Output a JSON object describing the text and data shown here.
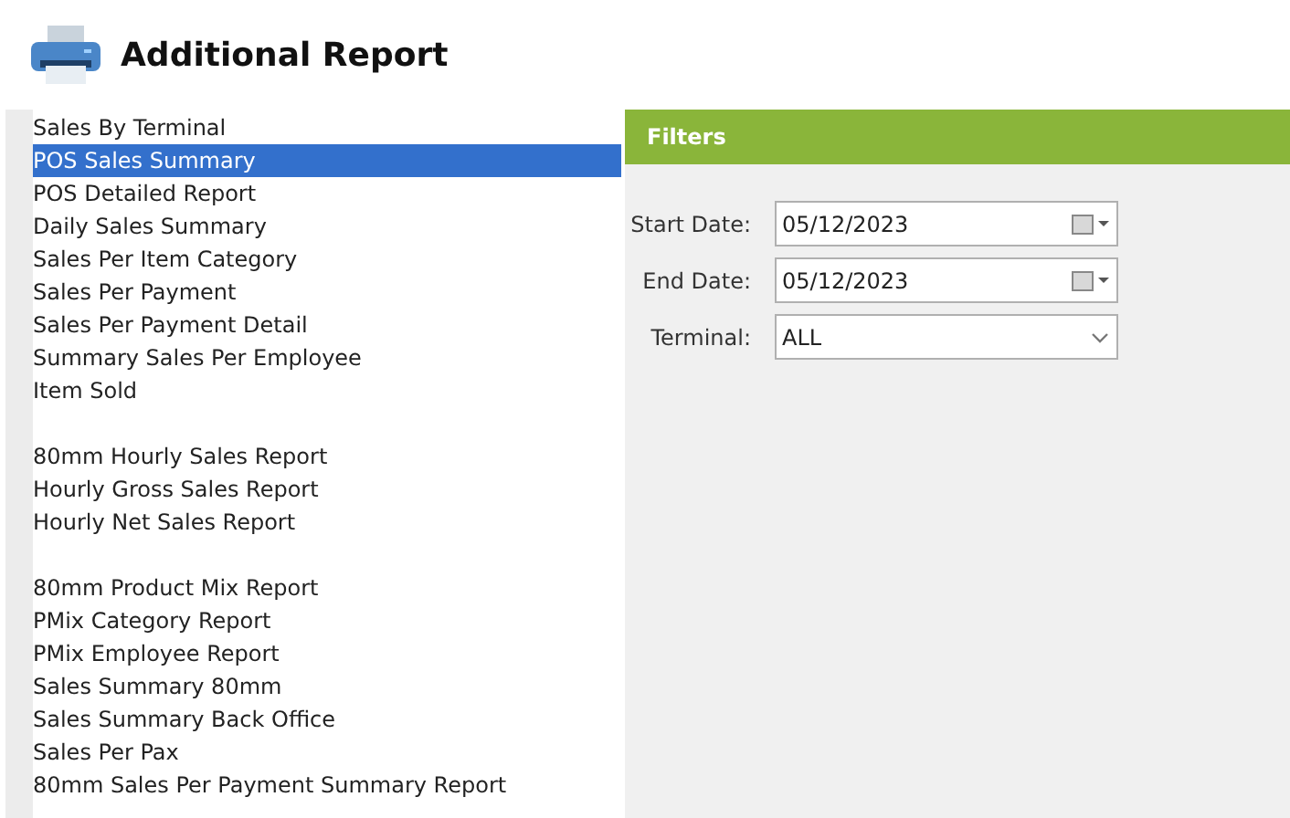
{
  "header": {
    "title": "Additional Report"
  },
  "report_groups": [
    {
      "items": [
        {
          "label": "Sales By Terminal",
          "selected": false
        },
        {
          "label": "POS Sales Summary",
          "selected": true
        },
        {
          "label": "POS Detailed Report",
          "selected": false
        },
        {
          "label": "Daily Sales Summary",
          "selected": false
        },
        {
          "label": "Sales Per Item Category",
          "selected": false
        },
        {
          "label": "Sales Per Payment",
          "selected": false
        },
        {
          "label": "Sales Per Payment Detail",
          "selected": false
        },
        {
          "label": "Summary Sales Per Employee",
          "selected": false
        },
        {
          "label": "Item Sold",
          "selected": false
        }
      ]
    },
    {
      "items": [
        {
          "label": "80mm Hourly Sales Report",
          "selected": false
        },
        {
          "label": "Hourly Gross Sales Report",
          "selected": false
        },
        {
          "label": "Hourly Net Sales Report",
          "selected": false
        }
      ]
    },
    {
      "items": [
        {
          "label": "80mm Product Mix Report",
          "selected": false
        },
        {
          "label": "PMix Category Report",
          "selected": false
        },
        {
          "label": "PMix Employee Report",
          "selected": false
        },
        {
          "label": "Sales Summary 80mm",
          "selected": false
        },
        {
          "label": "Sales Summary Back Office",
          "selected": false
        },
        {
          "label": "Sales Per Pax",
          "selected": false
        },
        {
          "label": "80mm Sales Per Payment Summary Report",
          "selected": false
        }
      ]
    }
  ],
  "filters": {
    "title": "Filters",
    "fields": [
      {
        "kind": "date",
        "label": "Start Date:",
        "value": "05/12/2023"
      },
      {
        "kind": "date",
        "label": "End Date:",
        "value": "05/12/2023"
      },
      {
        "kind": "dropdown",
        "label": "Terminal:",
        "value": "ALL"
      }
    ]
  }
}
